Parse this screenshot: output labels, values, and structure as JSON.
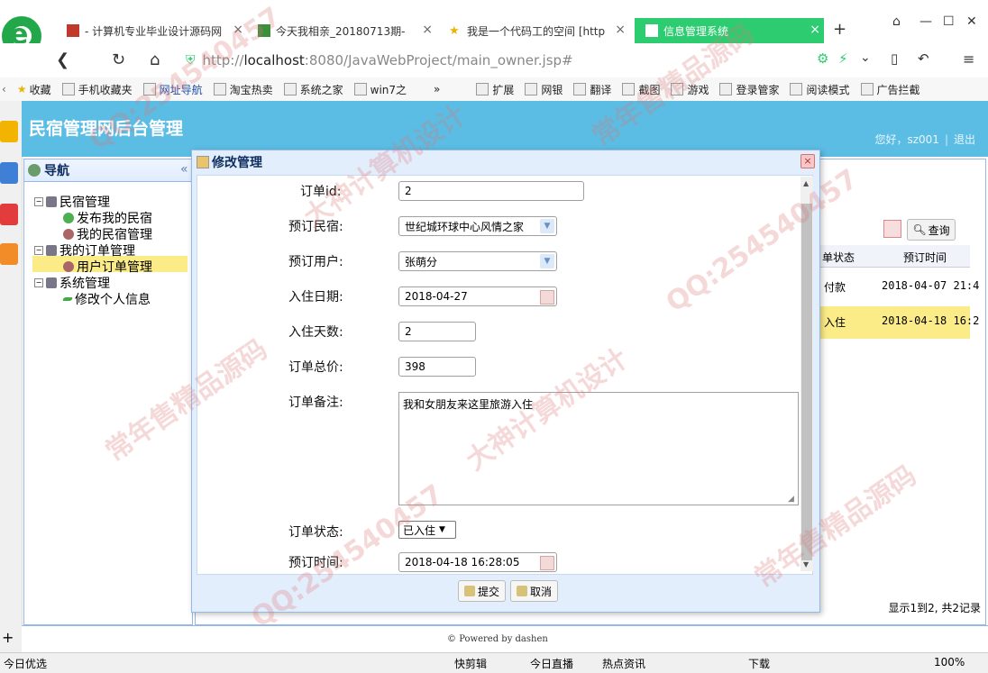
{
  "browser": {
    "tabs": [
      {
        "label": "- 计算机专业毕业设计源码网"
      },
      {
        "label": "今天我相亲_20180713期-"
      },
      {
        "label": "我是一个代码工的空间 [http"
      },
      {
        "label": "信息管理系统"
      }
    ],
    "url_prefix": "http://",
    "url_host": "localhost",
    "url_rest": ":8080/JavaWebProject/main_owner.jsp#",
    "bookmarks_left": [
      "收藏",
      "手机收藏夹",
      "网址导航",
      "淘宝热卖",
      "系统之家",
      "win7之"
    ],
    "bookmarks_right": [
      "扩展",
      "网银",
      "翻译",
      "截图",
      "游戏",
      "登录管家",
      "阅读模式",
      "广告拦截"
    ]
  },
  "app": {
    "title": "民宿管理网后台管理",
    "greeting": "您好，sz001",
    "logout": "退出"
  },
  "nav": {
    "title": "导航",
    "items": [
      {
        "label": "民宿管理"
      },
      {
        "label": "发布我的民宿"
      },
      {
        "label": "我的民宿管理"
      },
      {
        "label": "我的订单管理"
      },
      {
        "label": "用户订单管理"
      },
      {
        "label": "系统管理"
      },
      {
        "label": "修改个人信息"
      }
    ]
  },
  "content": {
    "search_button": "查询",
    "columns": [
      "单状态",
      "预订时间"
    ],
    "rows": [
      [
        "付款",
        "2018-04-07 21:4"
      ],
      [
        "入住",
        "2018-04-18 16:2"
      ]
    ],
    "pager": "显示1到2, 共2记录"
  },
  "footer": {
    "powered": "Powered by dashen"
  },
  "dialog": {
    "title": "修改管理",
    "fields": {
      "order_id": {
        "label": "订单id:",
        "value": "2"
      },
      "homestay": {
        "label": "预订民宿:",
        "value": "世纪城环球中心风情之家"
      },
      "user": {
        "label": "预订用户:",
        "value": "张萌分"
      },
      "checkin": {
        "label": "入住日期:",
        "value": "2018-04-27"
      },
      "days": {
        "label": "入住天数:",
        "value": "2"
      },
      "total": {
        "label": "订单总价:",
        "value": "398"
      },
      "remark": {
        "label": "订单备注:",
        "value": "我和女朋友来这里旅游入住"
      },
      "status": {
        "label": "订单状态:",
        "value": "已入住"
      },
      "order_time": {
        "label": "预订时间:",
        "value": "2018-04-18 16:28:05"
      }
    },
    "submit": "提交",
    "cancel": "取消"
  },
  "statusbar": {
    "left": "今日优选",
    "items": [
      "快剪辑",
      "今日直播",
      "热点资讯",
      "下载",
      "100%"
    ]
  },
  "watermarks": [
    "QQ:254540457",
    "常年售精品源码",
    "大神计算机设计",
    "QQ:254540457",
    "常年售精品源码",
    "大神计算机设计",
    "QQ:254540457",
    "常年售精品源码"
  ]
}
